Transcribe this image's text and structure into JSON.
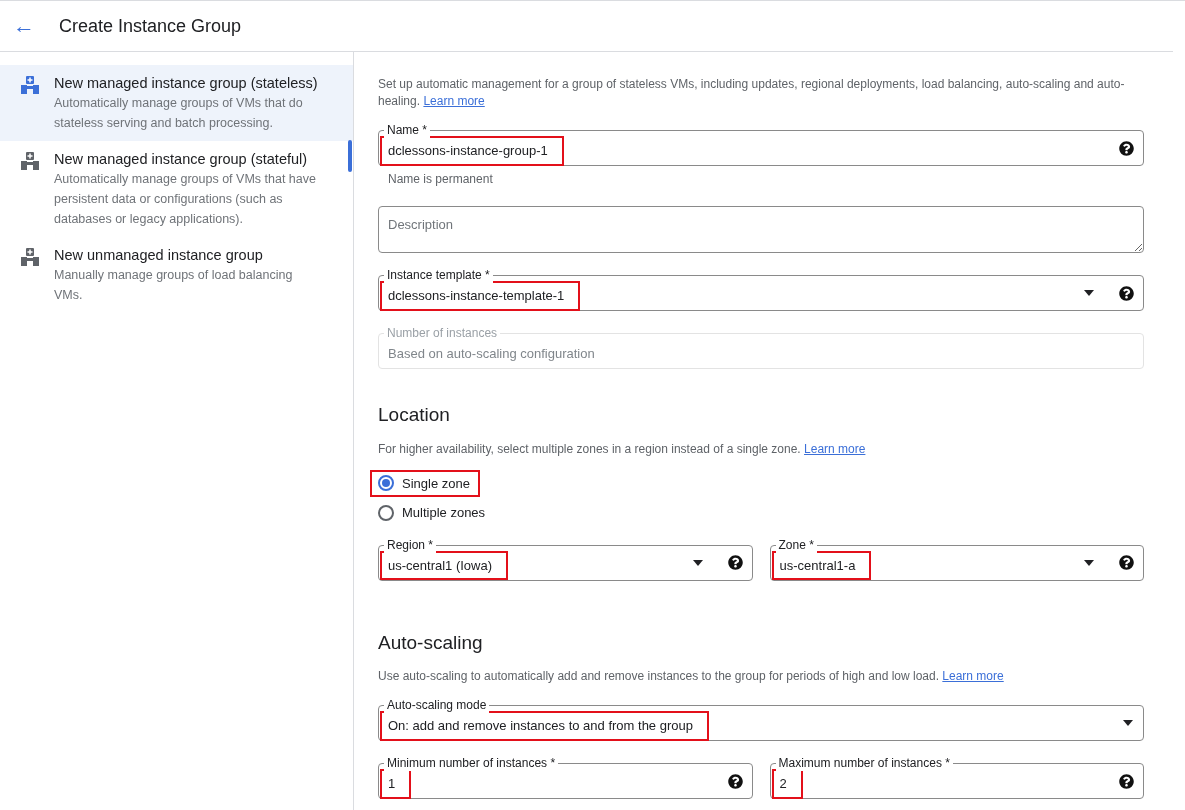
{
  "header": {
    "back": "←",
    "title": "Create Instance Group"
  },
  "sidebar": {
    "items": [
      {
        "title": "New managed instance group (stateless)",
        "description": "Automatically manage groups of VMs that do stateless serving and batch processing.",
        "selected": true
      },
      {
        "title": "New managed instance group (stateful)",
        "description": "Automatically manage groups of VMs that have persistent data or configurations (such as databases or legacy applications).",
        "selected": false
      },
      {
        "title": "New unmanaged instance group",
        "description": "Manually manage groups of load balancing VMs.",
        "selected": false
      }
    ]
  },
  "intro": {
    "text": "Set up automatic management for a group of stateless VMs, including updates, regional deployments, load balancing, auto-scaling and auto-healing.",
    "link": "Learn more"
  },
  "name_field": {
    "label": "Name *",
    "value": "dclessons-instance-group-1",
    "hint": "Name is permanent",
    "highlighted": true
  },
  "description_field": {
    "placeholder": "Description"
  },
  "template_field": {
    "label": "Instance template *",
    "value": "dclessons-instance-template-1",
    "highlighted": true
  },
  "instances_field": {
    "label": "Number of instances",
    "value": "Based on auto-scaling configuration",
    "disabled": true
  },
  "location": {
    "heading": "Location",
    "text": "For higher availability, select multiple zones in a region instead of a single zone.",
    "link": "Learn more",
    "options": [
      {
        "label": "Single zone",
        "selected": true,
        "highlighted": true
      },
      {
        "label": "Multiple zones",
        "selected": false,
        "highlighted": false
      }
    ],
    "region": {
      "label": "Region *",
      "value": "us-central1 (Iowa)",
      "highlighted": true
    },
    "zone": {
      "label": "Zone *",
      "value": "us-central1-a",
      "highlighted": true
    }
  },
  "autoscaling": {
    "heading": "Auto-scaling",
    "text": "Use auto-scaling to automatically add and remove instances to the group for periods of high and low load.",
    "link": "Learn more",
    "mode": {
      "label": "Auto-scaling mode",
      "value": "On: add and remove instances to and from the group",
      "highlighted": true
    },
    "min": {
      "label": "Minimum number of instances *",
      "value": "1",
      "highlighted": true
    },
    "max": {
      "label": "Maximum number of instances *",
      "value": "2",
      "highlighted": true
    }
  }
}
